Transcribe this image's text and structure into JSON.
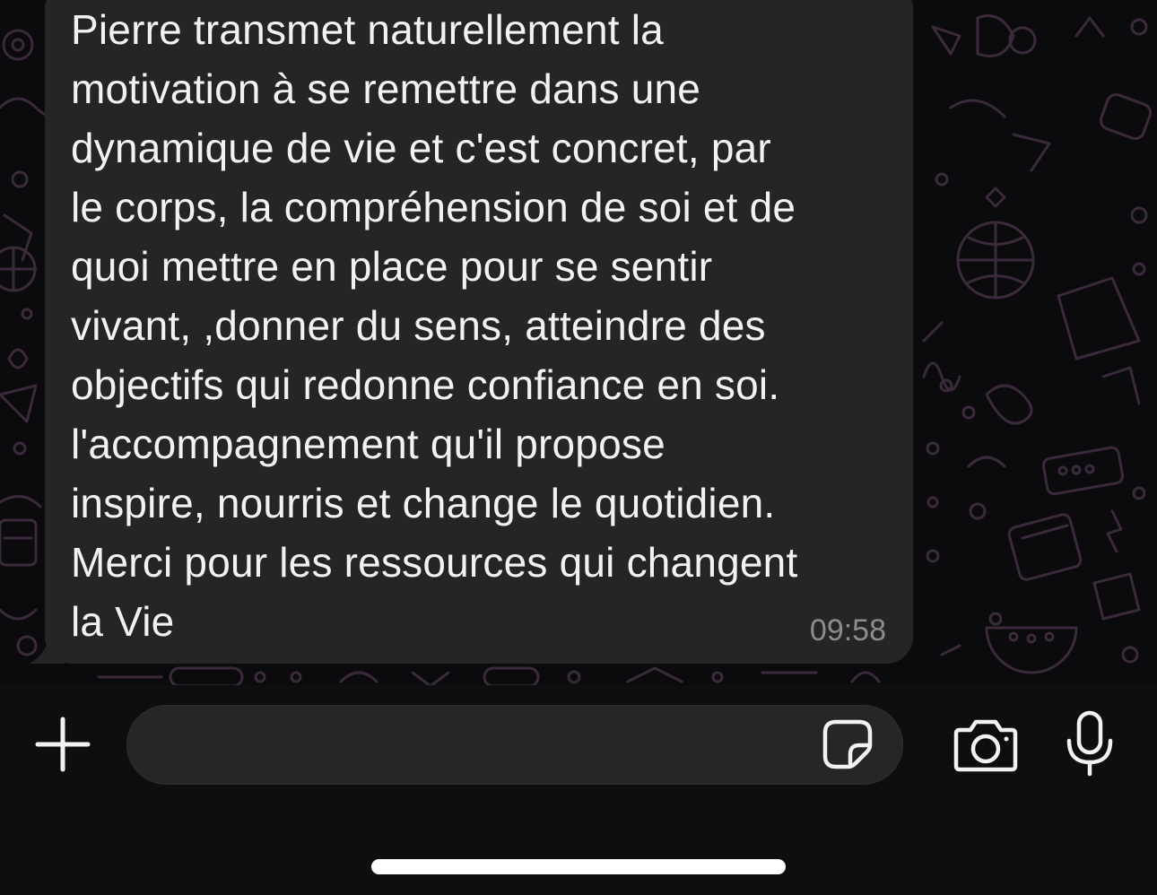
{
  "message": {
    "text": "Pierre transmet naturellement la\nmotivation à se remettre dans une\ndynamique de vie et c'est  concret, par\nle corps, la compréhension de soi et de\nquoi mettre en place pour se sentir\nvivant, ,donner du sens, atteindre des\nobjectifs qui redonne confiance en soi.\nl'accompagnement qu'il propose\ninspire, nourris et change le quotidien.\nMerci pour les ressources qui changent\nla Vie",
    "time": "09:58"
  },
  "composer": {
    "value": "",
    "placeholder": ""
  },
  "icons": {
    "attach": "plus-icon",
    "sticker": "sticker-icon",
    "camera": "camera-icon",
    "mic": "microphone-icon"
  },
  "colors": {
    "bubble": "#242626",
    "wallpaper_doodle": "#3a2a3c",
    "text": "#f2f2f2",
    "timestamp": "#8c8d8d",
    "bar": "#0e0e0e"
  }
}
